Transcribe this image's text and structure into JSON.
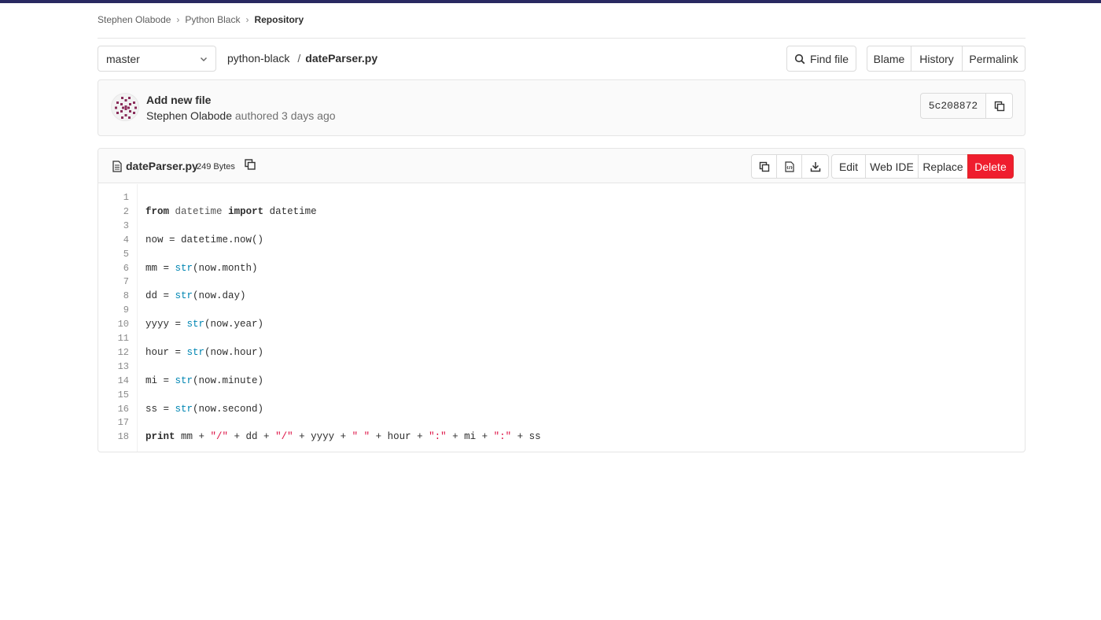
{
  "breadcrumb": [
    {
      "label": "Stephen Olabode"
    },
    {
      "label": "Python Black"
    },
    {
      "label": "Repository"
    }
  ],
  "branch": {
    "selected": "master"
  },
  "path": {
    "repo": "python-black",
    "separator": "/",
    "file": "dateParser.py"
  },
  "toolbar": {
    "find_file": "Find file",
    "blame": "Blame",
    "history": "History",
    "permalink": "Permalink"
  },
  "commit": {
    "title": "Add new file",
    "author": "Stephen Olabode",
    "meta": "authored 3 days ago",
    "sha": "5c208872"
  },
  "file": {
    "name": "dateParser.py",
    "size": "249 Bytes",
    "actions": {
      "edit": "Edit",
      "web_ide": "Web IDE",
      "replace": "Replace",
      "delete": "Delete"
    }
  },
  "code_lines": [
    {
      "n": "1",
      "tokens": []
    },
    {
      "n": "2",
      "tokens": [
        {
          "t": "kw",
          "v": "from"
        },
        {
          "t": "",
          "v": " "
        },
        {
          "t": "nn",
          "v": "datetime"
        },
        {
          "t": "",
          "v": " "
        },
        {
          "t": "kw",
          "v": "import"
        },
        {
          "t": "",
          "v": " datetime"
        }
      ]
    },
    {
      "n": "3",
      "tokens": []
    },
    {
      "n": "4",
      "tokens": [
        {
          "t": "",
          "v": "now = datetime.now()"
        }
      ]
    },
    {
      "n": "5",
      "tokens": []
    },
    {
      "n": "6",
      "tokens": [
        {
          "t": "",
          "v": "mm = "
        },
        {
          "t": "bi",
          "v": "str"
        },
        {
          "t": "",
          "v": "(now.month)"
        }
      ]
    },
    {
      "n": "7",
      "tokens": []
    },
    {
      "n": "8",
      "tokens": [
        {
          "t": "",
          "v": "dd = "
        },
        {
          "t": "bi",
          "v": "str"
        },
        {
          "t": "",
          "v": "(now.day)"
        }
      ]
    },
    {
      "n": "9",
      "tokens": []
    },
    {
      "n": "10",
      "tokens": [
        {
          "t": "",
          "v": "yyyy = "
        },
        {
          "t": "bi",
          "v": "str"
        },
        {
          "t": "",
          "v": "(now.year)"
        }
      ]
    },
    {
      "n": "11",
      "tokens": []
    },
    {
      "n": "12",
      "tokens": [
        {
          "t": "",
          "v": "hour = "
        },
        {
          "t": "bi",
          "v": "str"
        },
        {
          "t": "",
          "v": "(now.hour)"
        }
      ]
    },
    {
      "n": "13",
      "tokens": []
    },
    {
      "n": "14",
      "tokens": [
        {
          "t": "",
          "v": "mi = "
        },
        {
          "t": "bi",
          "v": "str"
        },
        {
          "t": "",
          "v": "(now.minute)"
        }
      ]
    },
    {
      "n": "15",
      "tokens": []
    },
    {
      "n": "16",
      "tokens": [
        {
          "t": "",
          "v": "ss = "
        },
        {
          "t": "bi",
          "v": "str"
        },
        {
          "t": "",
          "v": "(now.second)"
        }
      ]
    },
    {
      "n": "17",
      "tokens": []
    },
    {
      "n": "18",
      "tokens": [
        {
          "t": "kw",
          "v": "print"
        },
        {
          "t": "",
          "v": " mm + "
        },
        {
          "t": "st",
          "v": "\"/\""
        },
        {
          "t": "",
          "v": " + dd + "
        },
        {
          "t": "st",
          "v": "\"/\""
        },
        {
          "t": "",
          "v": " + yyyy + "
        },
        {
          "t": "st",
          "v": "\" \""
        },
        {
          "t": "",
          "v": " + hour + "
        },
        {
          "t": "st",
          "v": "\":\""
        },
        {
          "t": "",
          "v": " + mi + "
        },
        {
          "t": "st",
          "v": "\":\""
        },
        {
          "t": "",
          "v": " + ss"
        }
      ]
    }
  ],
  "icons": {
    "search": "search-icon",
    "chevron": "chevron-down-icon",
    "copy": "copy-icon",
    "file": "file-icon",
    "raw": "raw-file-icon",
    "download": "download-icon",
    "avatar": "identicon"
  },
  "colors": {
    "topbar": "#292961",
    "delete": "#ef1d2e",
    "builtin": "#0086b3",
    "string": "#dd1144"
  }
}
